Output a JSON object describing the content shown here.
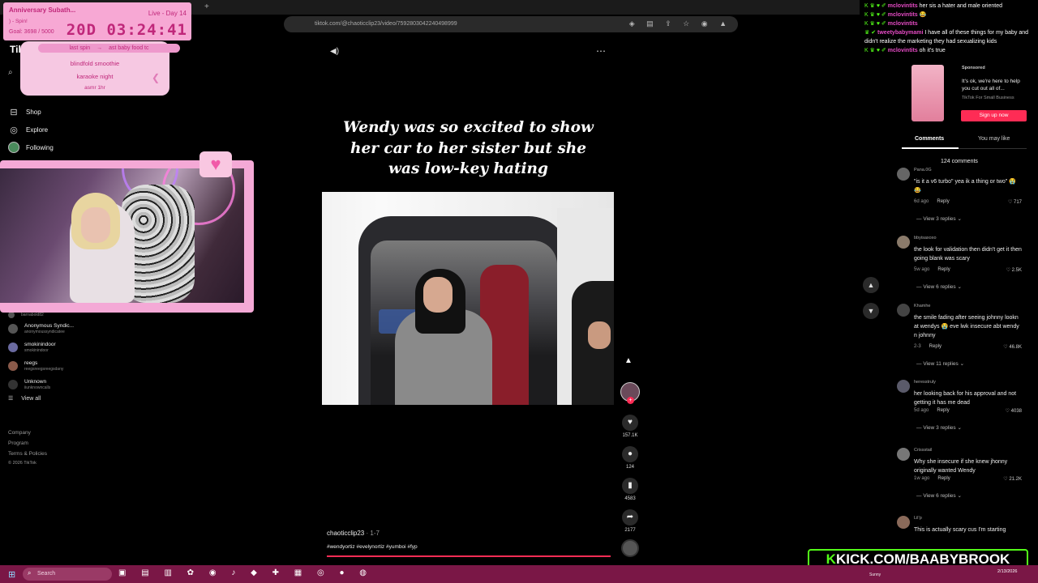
{
  "browser": {
    "url": "tiktok.com/@chaoticclip23/video/7592803042240498999",
    "tab_add": "+"
  },
  "subathon": {
    "title": "Anniversary Subath...",
    "status": "Live - Day 14",
    "spin": ") - Spin!",
    "goal": "Goal: 3698 / 5000",
    "timer": "20D 03:24:41"
  },
  "spin_panel": {
    "top_left": "last spin",
    "top_right": "ast baby food tc",
    "items": [
      "blindfold smoothie",
      "karaoke night",
      "asmr 1hr"
    ]
  },
  "sidebar": {
    "logo": "TikTok",
    "nav": [
      {
        "label": "Shop",
        "icon": "shop-icon"
      },
      {
        "label": "Explore",
        "icon": "compass-icon"
      },
      {
        "label": "Following",
        "icon": "avatar-icon"
      }
    ],
    "following": [
      {
        "name": "",
        "handle": "barnabold82"
      },
      {
        "name": "Anonymous Syndic...",
        "handle": "anonymoussyndicatee"
      },
      {
        "name": "smokinindoor",
        "handle": "smokinindoor"
      },
      {
        "name": "reegs",
        "handle": "reegsreegsreegsdany"
      },
      {
        "name": "Unknown",
        "handle": "iiunknowncalls"
      }
    ],
    "view_all": "View all",
    "footer": [
      "Company",
      "Program",
      "Terms & Policies",
      "© 2026 TikTok"
    ]
  },
  "video": {
    "caption": "Wendy was so excited to show her car to her sister but she was low-key hating",
    "author": "chaoticclip23",
    "date": "· 1-7",
    "tags": "#wendyortiz #evelynortiz #yumboi #fyp",
    "progress": 1.0
  },
  "actions": {
    "likes": "157.1K",
    "comments": "124",
    "saves": "4583",
    "shares": "2177"
  },
  "chat": [
    {
      "user": "mclovintits",
      "text": "her sis a hater and male oriented"
    },
    {
      "user": "mclovintits",
      "text": "😂"
    },
    {
      "user": "mclovintits",
      "text": ""
    },
    {
      "user": "tweetybabymami",
      "text": "I have all of these things for my baby and didn't realize the marketing they had sexualizing kids"
    },
    {
      "user": "mclovintits",
      "text": "oh it's true"
    }
  ],
  "ad": {
    "sponsored": "Sponsored",
    "text": "It's ok, we're here to help you cut out all of...",
    "brand": "TikTok For Small Business",
    "cta": "Sign up now"
  },
  "comments_panel": {
    "tab_comments": "Comments",
    "tab_you_may_like": "You may like",
    "count": "124 comments",
    "items": [
      {
        "user": "Pana.0G",
        "text": "\"is it a v6 turbo\" yea ik a thing or two\" 😭 😂",
        "age": "6d ago",
        "reply": "Reply",
        "likes": "717",
        "replies": "View 3 replies"
      },
      {
        "user": "bbyisaxoxo",
        "text": "the look for validation then didn't get it then going blank was scary",
        "age": "5w ago",
        "reply": "Reply",
        "likes": "2.5K",
        "replies": "View 6 replies"
      },
      {
        "user": "Khamhe",
        "text": "the smile fading after seeing johnny lookn at wendys 😭 eve lwk insecure abt wendy n johnny",
        "age": "2-3",
        "reply": "Reply",
        "likes": "46.8K",
        "replies": "View 11 replies"
      },
      {
        "user": "heresstruly",
        "text": "her looking back for his approval and not getting it has me dead",
        "age": "5d ago",
        "reply": "Reply",
        "likes": "4038",
        "replies": "View 3 replies"
      },
      {
        "user": "Crissstail",
        "text": "Why she insecure if she knew jhonny originally wanted Wendy",
        "age": "1w ago",
        "reply": "Reply",
        "likes": "21.2K",
        "replies": "View 6 replies"
      },
      {
        "user": "Lil’p",
        "text": "This is actually scary cus I'm starting",
        "age": "",
        "reply": "",
        "likes": "",
        "replies": ""
      }
    ]
  },
  "kick_banner": {
    "k": "K",
    "text": "KICK.COM/BAABYBROOK"
  },
  "taskbar": {
    "search": "Search",
    "weather": "Sunny",
    "time": "",
    "date": "2/13/2026"
  }
}
